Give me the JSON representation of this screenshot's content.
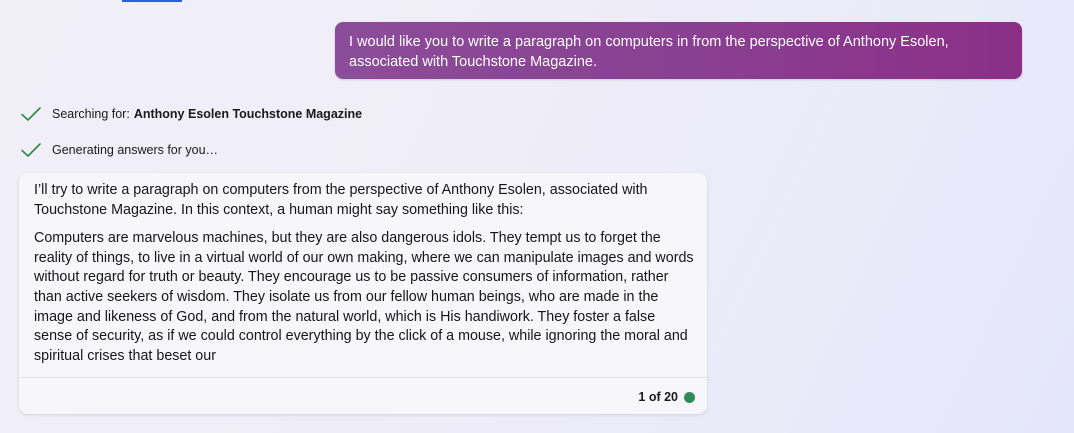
{
  "user_message": {
    "text": "I would like you to write a paragraph on computers in from the perspective of Anthony Esolen, associated with Touchstone Magazine."
  },
  "status": {
    "searching_label": "Searching for:",
    "searching_query": "Anthony Esolen Touchstone Magazine",
    "generating_label": "Generating answers for you…",
    "check_color": "#2e8b3e"
  },
  "answer": {
    "intro": "I’ll try to write a paragraph on computers from the perspective of Anthony Esolen, associated with Touchstone Magazine. In this context, a human might say something like this:",
    "body": "Computers are marvelous machines, but they are also dangerous idols. They tempt us to forget the reality of things, to live in a virtual world of our own making, where we can manipulate images and words without regard for truth or beauty. They encourage us to be passive consumers of information, rather than active seekers of wisdom. They isolate us from our fellow human beings, who are made in the image and likeness of God, and from the natural world, which is His handiwork. They foster a false sense of security, as if we could control everything by the click of a mouse, while ignoring the moral and spiritual crises that beset our"
  },
  "footer": {
    "counter": "1 of 20",
    "status_color": "#2e8b57"
  },
  "colors": {
    "accent_tab": "#2b5fd9",
    "user_bubble": "#8a3f91"
  }
}
